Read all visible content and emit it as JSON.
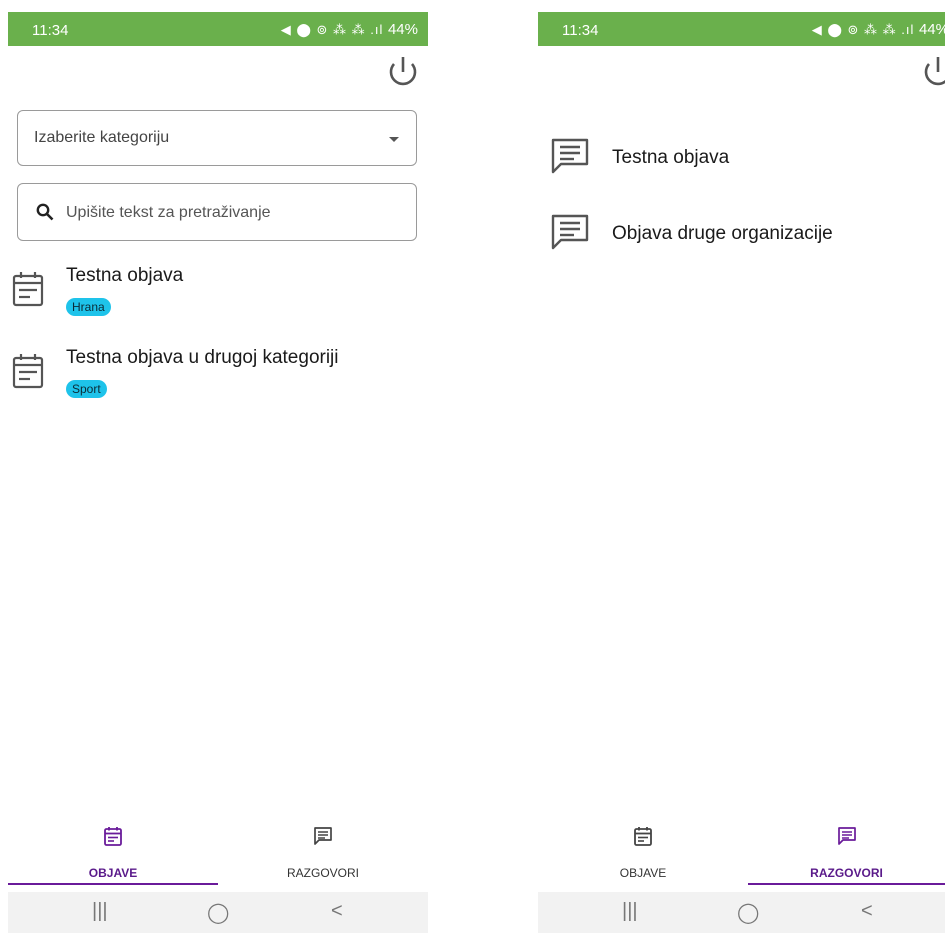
{
  "left": {
    "status": {
      "time": "11:34",
      "icons": "◀︎ ⬤ ⊚ ⁂ ⁂ .ıl",
      "battery": "44%"
    },
    "category_select": {
      "value": "Izaberite kategoriju"
    },
    "search": {
      "placeholder": "Upišite tekst za pretraživanje"
    },
    "posts": [
      {
        "title": "Testna objava",
        "tag": "Hrana"
      },
      {
        "title": "Testna objava u drugoj kategoriji",
        "tag": "Sport"
      }
    ],
    "tabs": [
      {
        "label": "OBJAVE"
      },
      {
        "label": "RAZGOVORI"
      }
    ]
  },
  "right": {
    "status": {
      "time": "11:34",
      "icons": "◀︎ ⬤ ⊚ ⁂ ⁂ .ıl",
      "battery": "44%"
    },
    "conversations": [
      {
        "title": "Testna objava"
      },
      {
        "title": "Objava druge organizacije"
      }
    ],
    "tabs": [
      {
        "label": "OBJAVE"
      },
      {
        "label": "RAZGOVORI"
      }
    ]
  },
  "nav": {
    "recent": "|||",
    "home": "◯",
    "back": "<"
  },
  "colors": {
    "status_bar": "#6ab04c",
    "accent": "#6a1b9a",
    "badge": "#1ec3ea"
  },
  "active_tab": {
    "left": "OBJAVE",
    "right": "RAZGOVORI"
  }
}
